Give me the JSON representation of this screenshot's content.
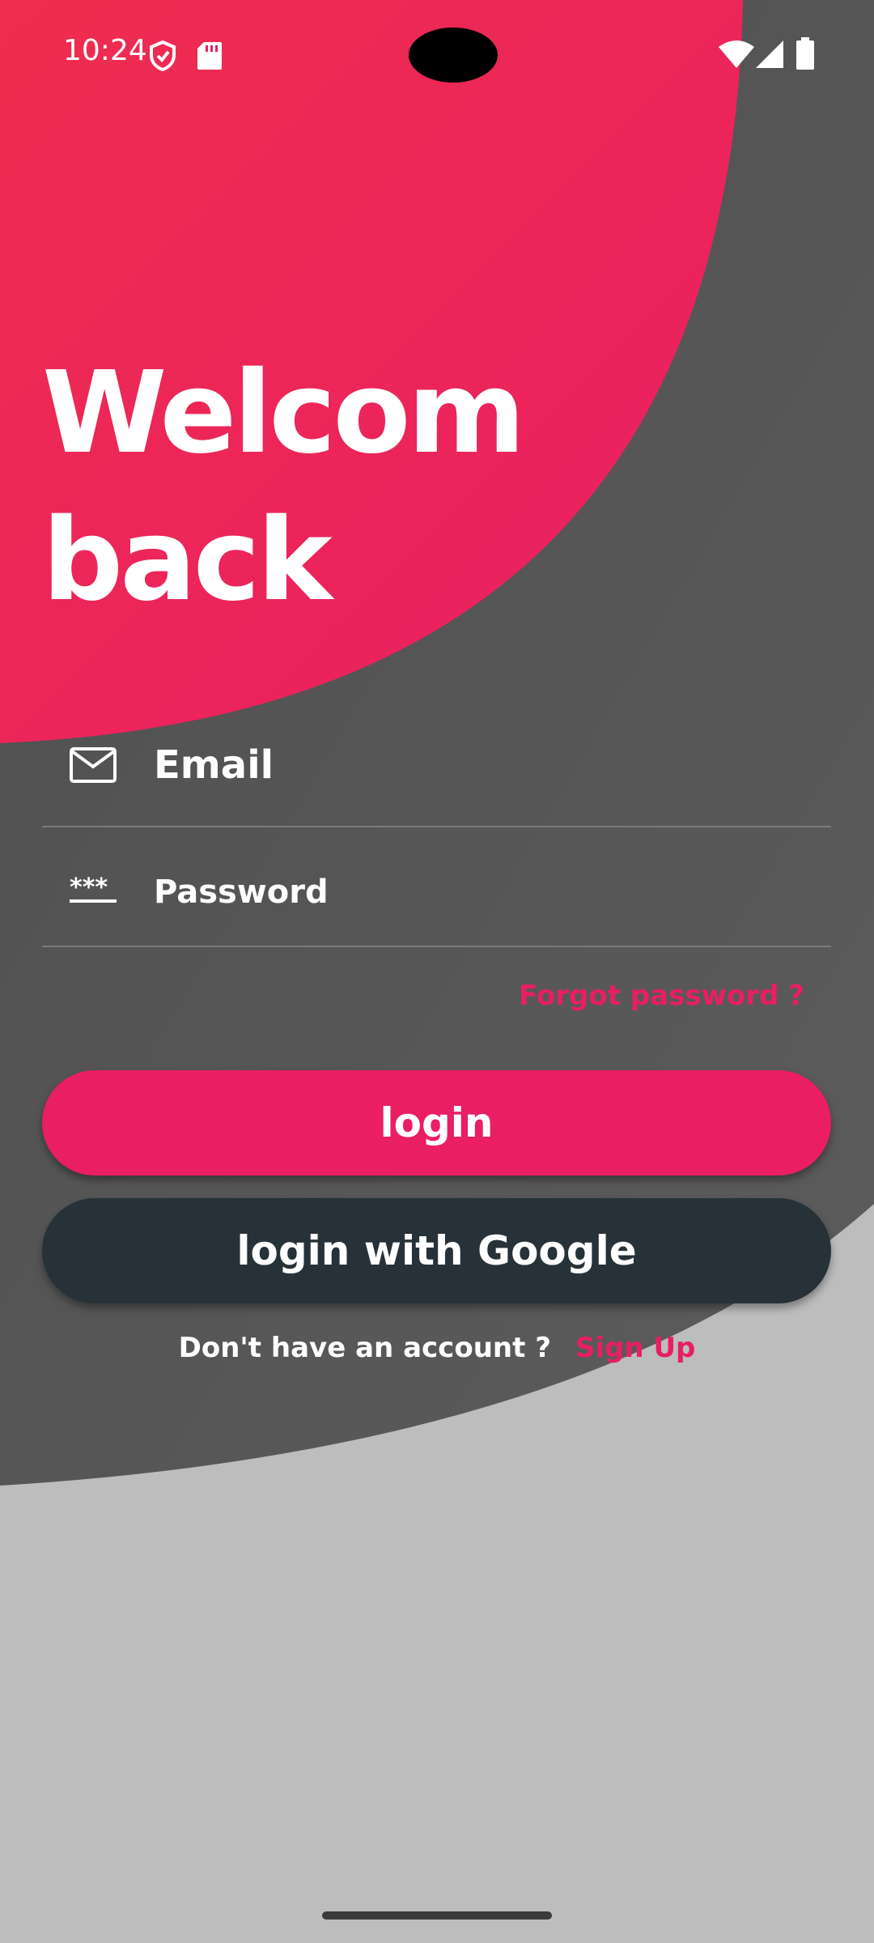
{
  "status_bar": {
    "time": "10:24",
    "icons": [
      "shield-icon",
      "sd-card-icon",
      "wifi-icon",
      "signal-icon",
      "battery-icon"
    ]
  },
  "welcome": {
    "line1": "Welcom",
    "line2": "back"
  },
  "form": {
    "email_placeholder": "Email",
    "password_placeholder": "Password",
    "email_icon": "mail-icon",
    "password_icon": "password-dots-icon",
    "forgot_label": "Forgot password ?"
  },
  "buttons": {
    "login_label": "login",
    "google_label": "login with Google"
  },
  "signup": {
    "prompt": "Don't have an account ?",
    "link_label": "Sign Up"
  },
  "colors": {
    "accent": "#e91e63",
    "dark_panel": "#535353",
    "google_button": "#263238",
    "bottom_bg": "#bdbdbd"
  }
}
